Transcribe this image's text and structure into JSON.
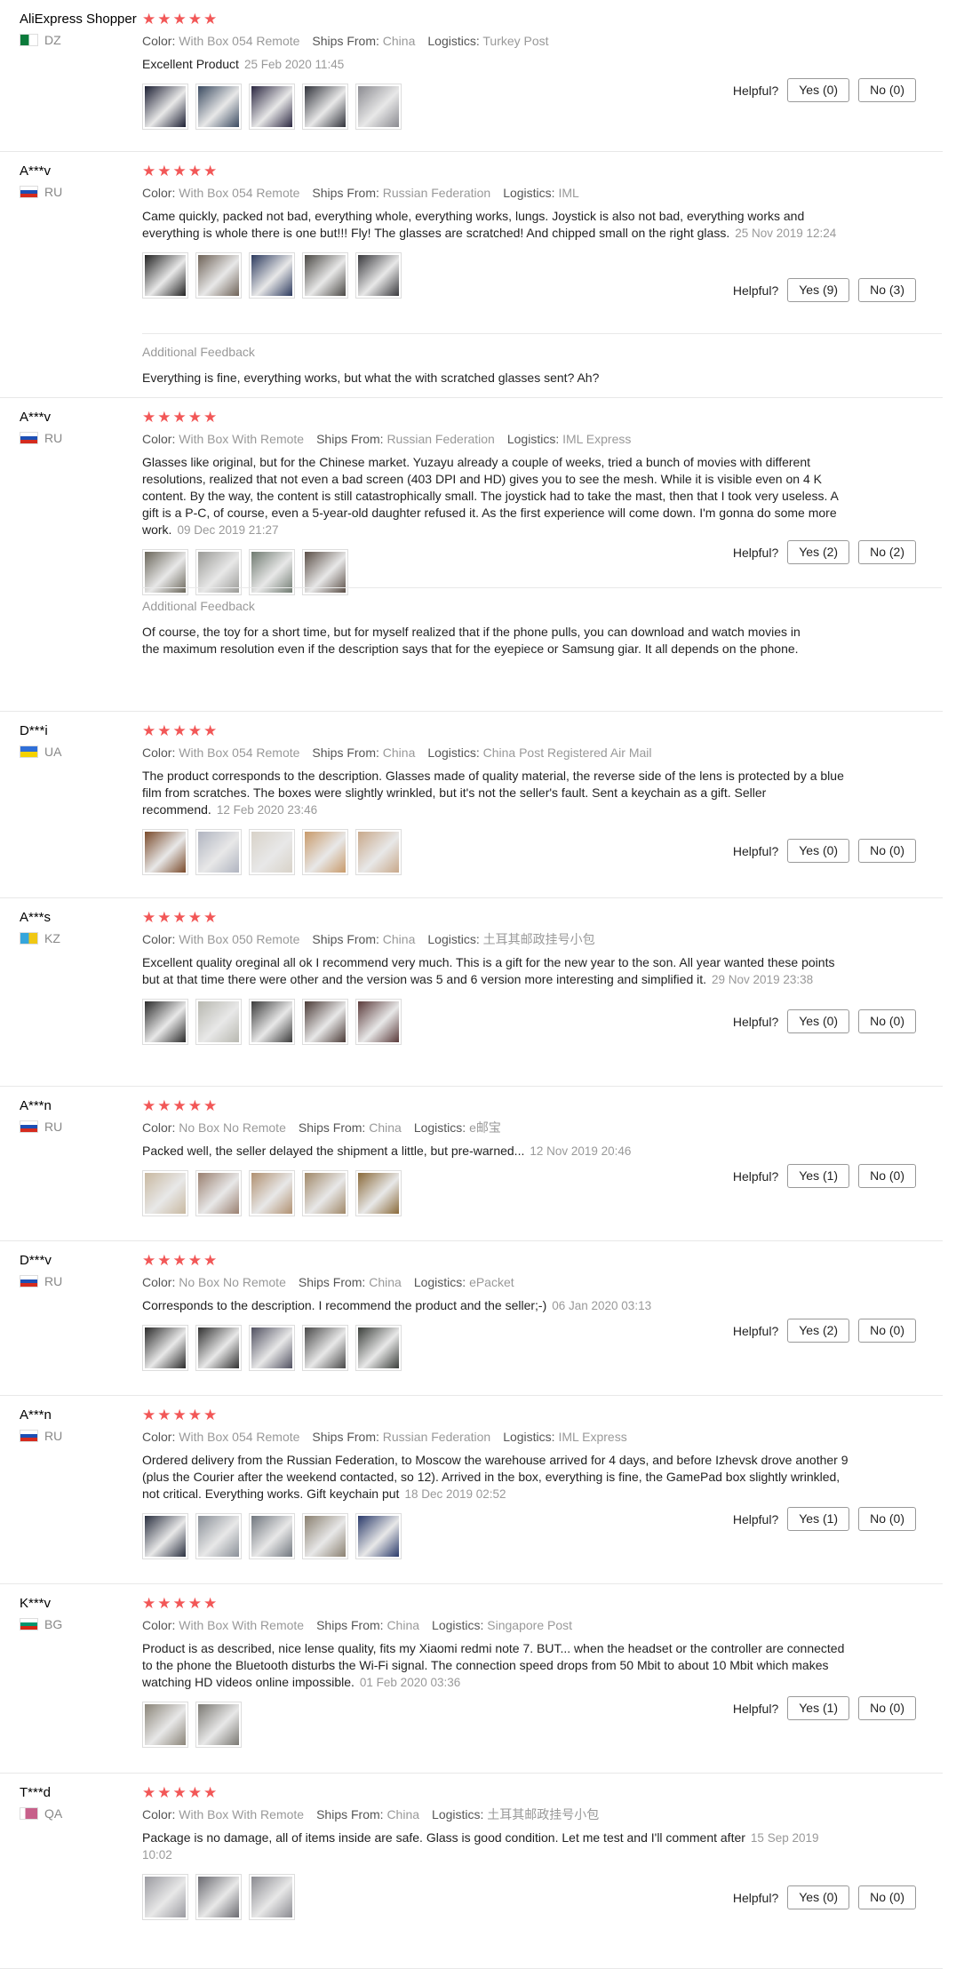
{
  "labels": {
    "color": "Color:",
    "ships_from": "Ships From:",
    "logistics": "Logistics:",
    "helpful": "Helpful?",
    "additional_feedback": "Additional Feedback"
  },
  "star_color": "#f25757",
  "reviews": [
    {
      "user": "AliExpress Shopper",
      "country": "DZ",
      "flag": [
        "#0b7a3b",
        "#ffffff"
      ],
      "stars": 5,
      "color": "With Box 054 Remote",
      "ships_from": "China",
      "logistics": "Turkey Post",
      "text": "Excellent Product",
      "date": "25 Feb 2020 11:45",
      "yes": "Yes (0)",
      "no": "No (0)",
      "thumbs": [
        "#1c1f33",
        "#3a4a60",
        "#2a2640",
        "#30323a",
        "#8a8a90"
      ]
    },
    {
      "user": "A***v",
      "country": "RU",
      "flag": [
        "#ffffff",
        "#1c4fb5",
        "#d52b1e"
      ],
      "stars": 5,
      "color": "With Box 054 Remote",
      "ships_from": "Russian Federation",
      "logistics": "IML",
      "text": "Came quickly, packed not bad, everything whole, everything works, lungs. Joystick is also not bad, everything works and everything is whole there is one but!!! Fly! The glasses are scratched! And chipped small on the right glass.",
      "date": "25 Nov 2019 12:24",
      "yes": "Yes (9)",
      "no": "No (3)",
      "thumbs": [
        "#222222",
        "#6e6257",
        "#2c3a5e",
        "#4a4844",
        "#38383c"
      ],
      "additional": "Everything is fine, everything works, but what the with scratched glasses sent? Ah?"
    },
    {
      "user": "A***v",
      "country": "RU",
      "flag": [
        "#ffffff",
        "#1c4fb5",
        "#d52b1e"
      ],
      "stars": 5,
      "color": "With Box With Remote",
      "ships_from": "Russian Federation",
      "logistics": "IML Express",
      "text": "Glasses like original, but for the Chinese market. Yuzayu already a couple of weeks, tried a bunch of movies with different resolutions, realized that not even a bad screen (403 DPI and HD) gives you to see the mesh. While it is visible even on 4 K content. By the way, the content is still catastrophically small. The joystick had to take the mast, then that I took very useless. A gift is a P-C, of course, even a 5-year-old daughter refused it. As the first experience will come down. I'm gonna do some more work.",
      "date": "09 Dec 2019 21:27",
      "yes": "Yes (2)",
      "no": "No (2)",
      "thumbs": [
        "#6a665a",
        "#9a9a96",
        "#6f7a70",
        "#5a4e46"
      ],
      "additional": "Of course, the toy for a short time, but for myself realized that if the phone pulls, you can download and watch movies in the maximum resolution even if the description says that for the eyepiece or Samsung giar. It all depends on the phone."
    },
    {
      "user": "D***i",
      "country": "UA",
      "flag": [
        "#2f6fd8",
        "#f5d200"
      ],
      "stars": 5,
      "color": "With Box 054 Remote",
      "ships_from": "China",
      "logistics": "China Post Registered Air Mail",
      "text": "The product corresponds to the description. Glasses made of quality material, the reverse side of the lens is protected by a blue film from scratches. The boxes were slightly wrinkled, but it's not the seller's fault. Sent a keychain as a gift. Seller recommend.",
      "date": "12 Feb 2020 23:46",
      "yes": "Yes (0)",
      "no": "No (0)",
      "thumbs": [
        "#7a4a2a",
        "#b0b4c0",
        "#d8d2c8",
        "#c89a6a",
        "#c8a88a"
      ]
    },
    {
      "user": "A***s",
      "country": "KZ",
      "flag": [
        "#35a6dc",
        "#f0c814"
      ],
      "stars": 5,
      "color": "With Box 050 Remote",
      "ships_from": "China",
      "logistics": "土耳其邮政挂号小包",
      "text": "Excellent quality oreginal all ok I recommend very much. This is a gift for the new year to the son. All year wanted these points but at that time there were other and the version was 5 and 6 version more interesting and simplified it.",
      "date": "29 Nov 2019 23:38",
      "yes": "Yes (0)",
      "no": "No (0)",
      "thumbs": [
        "#2a2a2a",
        "#b8b8b0",
        "#3a3a3a",
        "#4a3a36",
        "#5a3a3a"
      ]
    },
    {
      "user": "A***n",
      "country": "RU",
      "flag": [
        "#ffffff",
        "#1c4fb5",
        "#d52b1e"
      ],
      "stars": 5,
      "color": "No Box No Remote",
      "ships_from": "China",
      "logistics": "e邮宝",
      "text": "Packed well, the seller delayed the shipment a little, but pre-warned...",
      "date": "12 Nov 2019 20:46",
      "yes": "Yes (1)",
      "no": "No (0)",
      "thumbs": [
        "#c8b8a0",
        "#9a8070",
        "#b09070",
        "#a08868",
        "#8a6a3a"
      ]
    },
    {
      "user": "D***v",
      "country": "RU",
      "flag": [
        "#ffffff",
        "#1c4fb5",
        "#d52b1e"
      ],
      "stars": 5,
      "color": "No Box No Remote",
      "ships_from": "China",
      "logistics": "ePacket",
      "text": "Corresponds to the description. I recommend the product and the seller;-)",
      "date": "06 Jan 2020 03:13",
      "yes": "Yes (2)",
      "no": "No (0)",
      "thumbs": [
        "#2a2a2a",
        "#303030",
        "#505060",
        "#484848",
        "#3a3e3a"
      ]
    },
    {
      "user": "A***n",
      "country": "RU",
      "flag": [
        "#ffffff",
        "#1c4fb5",
        "#d52b1e"
      ],
      "stars": 5,
      "color": "With Box 054 Remote",
      "ships_from": "Russian Federation",
      "logistics": "IML Express",
      "text": "Ordered delivery from the Russian Federation, to Moscow the warehouse arrived for 4 days, and before Izhevsk drove another 9 (plus the Courier after the weekend contacted, so 12). Arrived in the box, everything is fine, the GamePad box slightly wrinkled, not critical. Everything works. Gift keychain put",
      "date": "18 Dec 2019 02:52",
      "yes": "Yes (1)",
      "no": "No (0)",
      "thumbs": [
        "#2a3040",
        "#8a9098",
        "#70767e",
        "#8a8070",
        "#2a3a6a"
      ]
    },
    {
      "user": "K***v",
      "country": "BG",
      "flag": [
        "#ffffff",
        "#00966e",
        "#d62612"
      ],
      "stars": 5,
      "color": "With Box With Remote",
      "ships_from": "China",
      "logistics": "Singapore Post",
      "text": "Product is as described, nice lense quality, fits my Xiaomi redmi note 7. BUT... when the headset or the controller are connected to the phone the Bluetooth disturbs the Wi-Fi signal. The connection speed drops from 50 Mbit to about 10 Mbit which makes watching HD videos online impossible.",
      "date": "01 Feb 2020 03:36",
      "yes": "Yes (1)",
      "no": "No (0)",
      "thumbs": [
        "#8a8478",
        "#7a7872"
      ]
    },
    {
      "user": "T***d",
      "country": "QA",
      "flag": [
        "#ffffff",
        "#c7608a"
      ],
      "stars": 5,
      "color": "With Box With Remote",
      "ships_from": "China",
      "logistics": "土耳其邮政挂号小包",
      "text": "Package is no damage, all of items inside are safe. Glass is good condition. Let me test and I'll comment after",
      "date": "15 Sep 2019 10:02",
      "yes": "Yes (0)",
      "no": "No (0)",
      "thumbs": [
        "#9a9aa0",
        "#6a6a70",
        "#8a8a90"
      ]
    }
  ]
}
